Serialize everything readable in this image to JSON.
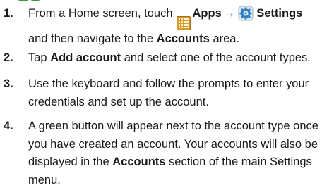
{
  "steps": [
    {
      "number": "1.",
      "line1": {
        "prefix": "From a Home screen, touch",
        "apps_label": "Apps",
        "arrow": "→",
        "settings_label": "Settings"
      },
      "line2": {
        "prefix": "and then navigate to the",
        "accounts_label": "Accounts",
        "suffix": "area."
      }
    },
    {
      "number": "2.",
      "text_prefix": "Tap",
      "bold": "Add account",
      "text_suffix": "and select one of the account types."
    },
    {
      "number": "3.",
      "line1": "Use the keyboard and follow the prompts to enter your",
      "line2": "credentials and set up the account."
    },
    {
      "number": "4.",
      "line1": "A green button will appear next to the account type once",
      "line2": "you have created an account. Your accounts will also be",
      "line3": {
        "prefix": "displayed in the",
        "bold": "Accounts",
        "suffix": "section of the main Settings"
      },
      "line4": "menu."
    }
  ],
  "icons": {
    "apps": "apps-grid-icon",
    "settings": "settings-gear-icon"
  },
  "colors": {
    "heading_accent": "#3a9b43",
    "apps_icon": "#d99a2b",
    "settings_icon": "#2f7fc1"
  }
}
